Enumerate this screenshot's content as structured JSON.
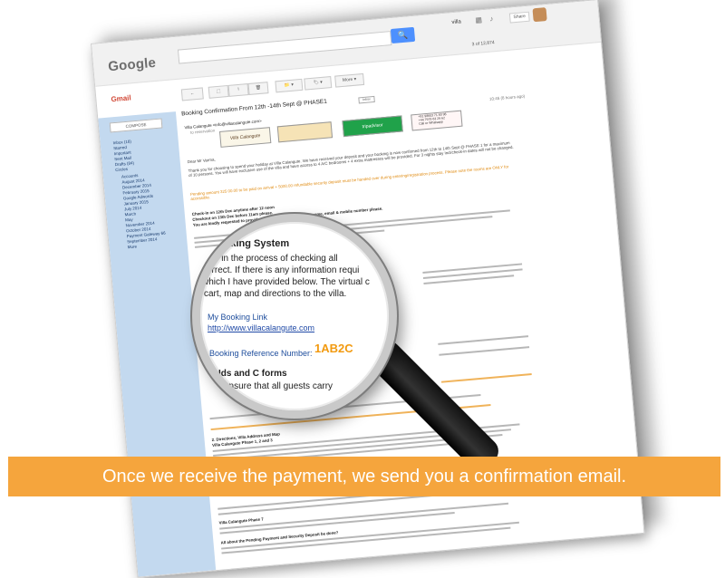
{
  "gmail": {
    "logo": "Google",
    "label": "Gmail",
    "search_button": "🔍",
    "account": "villa",
    "share": "Share",
    "pager": "3 of 12,874",
    "toolbar": [
      "←",
      "⬚",
      "!",
      "🗑",
      "📁 ▾",
      "🏷 ▾",
      "More ▾"
    ],
    "compose": "COMPOSE",
    "nav_items": [
      "Inbox (18)",
      "Starred",
      "Important",
      "Sent Mail",
      "Drafts (84)",
      "Circles",
      "Accounts",
      "August 2014",
      "December 2014",
      "February 2015",
      "Google Adwords",
      "January 2015",
      "July 2014",
      "March",
      "May",
      "November 2014",
      "October 2014",
      "Payment Gateway 66",
      "September 2014",
      "More"
    ],
    "subject": "Booking Confirmation  From 12th -14th Sept @ PHASE1",
    "chip": "Inbox",
    "sender": "Villa Calangute <info@villacalangute.com>",
    "to": "to reservation",
    "date": "10:45 (8 hours ago)",
    "banner_tripadvisor": "tripadvisor",
    "banner_phones": [
      "+91 98603 71 60 98",
      "+44 7979 63 29 62",
      "Call or Whatsapp"
    ],
    "villa_logo": "Villa Calangute",
    "greeting": "Dear Mr Varma,",
    "para1": "Thank you for choosing to spend your holiday at Villa Calangute. We have received your deposit and your booking is now confirmed from 12th to 14th Sept @ PHASE 1 for a maximum of 10 persons. You will have exclusive use of the villa and have access to 4 A/C bedrooms + 4 extra mattresses will be provided. For 3 nights stay Incl/check-in dates will not be changed.",
    "pending": "Pending amount 325 00.00 to be paid on arrival + 5000.00 refundable security deposit must be handed over during entering/registration process. Please note the rooms are ONLY for accessible.",
    "checkin": "Check-in on 12th Dec anytime after 12 noon",
    "checkout": "Checkout on 13th Dec  before 11am please.",
    "checkin_note": "You are kindly requested to provide Secondary contact person name, email & mobile number please."
  },
  "lens": {
    "heading": "Booking System",
    "line1": "are in the process of checking all",
    "line2": "correct. If there is any information requi",
    "line3": "which I have provided below.  The virtual c",
    "line4": "cart, map and directions to the villa.",
    "link_label": "My Booking Link",
    "link_url": "http://www.villacalangute.com",
    "ref_label": "Booking Reference Number:",
    "ref_code": "1AB2C",
    "heading2": "Ids and C forms",
    "line5": "ensure that all guests carry"
  },
  "lower_text": {
    "directions": "2. Directions, Villa Address and Map",
    "phase": "Villa Calangute Phase 1, 2 and 3",
    "phase7": "Villa Calangute Phase 7",
    "pending_title": "All about the Pending Payment and Security Deposit be done?"
  },
  "caption": "Once we receive the payment, we send you a confirmation email.",
  "colors": {
    "caption_bg": "#f5a53d",
    "highlight": "#f29a10",
    "link": "#1e4d9c",
    "sidebar": "#c3d9ef"
  }
}
